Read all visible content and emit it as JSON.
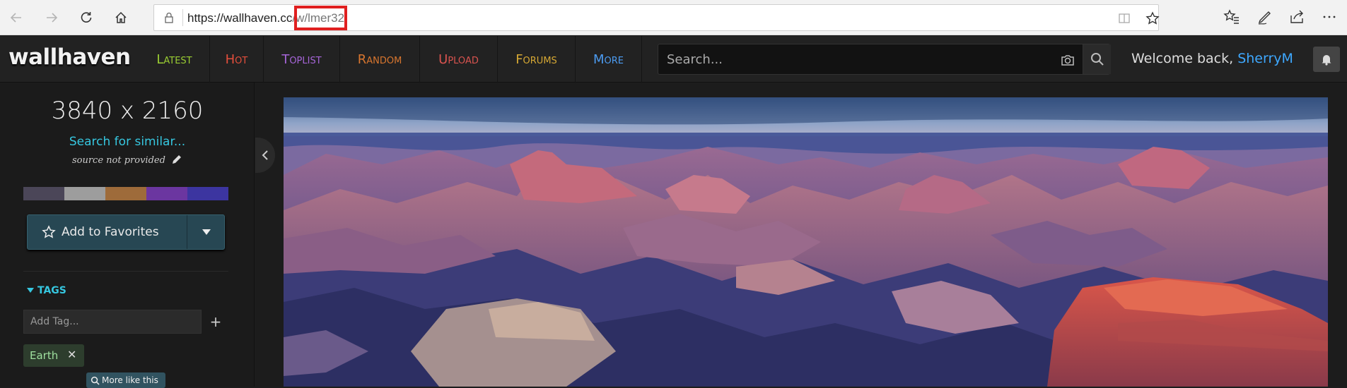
{
  "browser": {
    "url_prefix": "https://",
    "url_host": "wallhaven.cc",
    "url_path": "/w/lmer32",
    "highlight_color": "#e02020"
  },
  "site": {
    "logo": "wallhaven",
    "nav": [
      {
        "label": "Latest",
        "color": "#9acd32"
      },
      {
        "label": "Hot",
        "color": "#e34e3c"
      },
      {
        "label": "Toplist",
        "color": "#a665d8"
      },
      {
        "label": "Random",
        "color": "#d8762f"
      },
      {
        "label": "Upload",
        "color": "#d9534f"
      },
      {
        "label": "Forums",
        "color": "#d6a834"
      },
      {
        "label": "More",
        "color": "#4c9bf0"
      }
    ],
    "search_placeholder": "Search...",
    "welcome_text": "Welcome back,",
    "username": "SherryM"
  },
  "sidebar": {
    "resolution": "3840 x 2160",
    "similar_link": "Search for similar...",
    "source_text": "source not provided",
    "palette": [
      "#4b4658",
      "#9d9d9d",
      "#9e6b3a",
      "#6b36a0",
      "#3c35a0"
    ],
    "favorite_label": "Add to Favorites",
    "tags_heading": "TAGS",
    "tag_input_placeholder": "Add Tag...",
    "tags": [
      {
        "name": "Earth"
      }
    ],
    "more_like_label": "More like this"
  }
}
